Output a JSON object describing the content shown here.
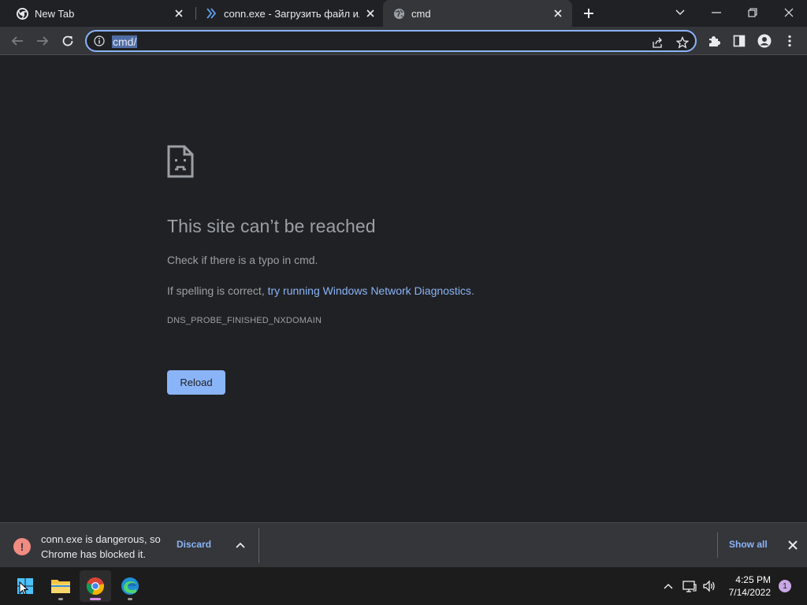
{
  "tabs": [
    {
      "title": "New Tab",
      "icon": "chrome-icon",
      "active": false
    },
    {
      "title": "conn.exe - Загрузить файл или с",
      "icon": "double-chevron-icon",
      "active": false
    },
    {
      "title": "cmd",
      "icon": "globe-icon",
      "active": true
    }
  ],
  "omnibox": {
    "url": "cmd/"
  },
  "error": {
    "title": "This site can’t be reached",
    "line1": "Check if there is a typo in cmd.",
    "line2_prefix": "If spelling is correct, ",
    "line2_link": "try running Windows Network Diagnostics",
    "line2_suffix": ".",
    "code": "DNS_PROBE_FINISHED_NXDOMAIN",
    "reload_label": "Reload"
  },
  "download": {
    "message": "conn.exe is dangerous, so Chrome has blocked it.",
    "discard_label": "Discard",
    "show_all_label": "Show all"
  },
  "taskbar": {
    "time": "4:25 PM",
    "date": "7/14/2022",
    "notification_count": "1"
  },
  "colors": {
    "accent": "#8ab4f8",
    "warning": "#f28b82",
    "background": "#202124",
    "toolbar": "#35363a"
  }
}
